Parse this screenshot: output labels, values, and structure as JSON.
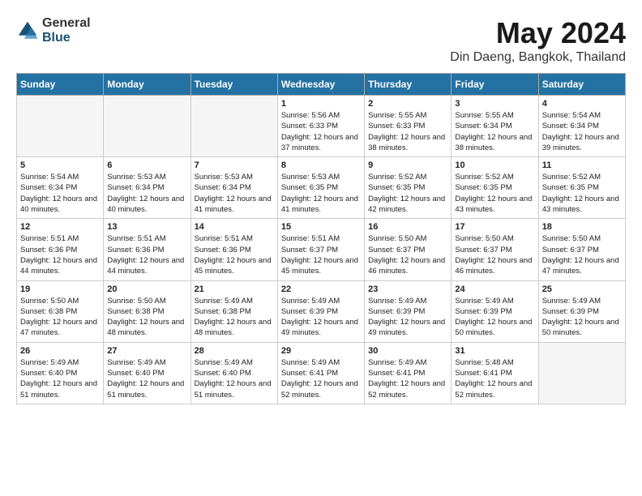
{
  "header": {
    "logo": {
      "general": "General",
      "blue": "Blue"
    },
    "title": "May 2024",
    "subtitle": "Din Daeng, Bangkok, Thailand"
  },
  "weekdays": [
    "Sunday",
    "Monday",
    "Tuesday",
    "Wednesday",
    "Thursday",
    "Friday",
    "Saturday"
  ],
  "weeks": [
    [
      {
        "day": "",
        "empty": true
      },
      {
        "day": "",
        "empty": true
      },
      {
        "day": "",
        "empty": true
      },
      {
        "day": "1",
        "sunrise": "5:56 AM",
        "sunset": "6:33 PM",
        "daylight": "12 hours and 37 minutes."
      },
      {
        "day": "2",
        "sunrise": "5:55 AM",
        "sunset": "6:33 PM",
        "daylight": "12 hours and 38 minutes."
      },
      {
        "day": "3",
        "sunrise": "5:55 AM",
        "sunset": "6:34 PM",
        "daylight": "12 hours and 38 minutes."
      },
      {
        "day": "4",
        "sunrise": "5:54 AM",
        "sunset": "6:34 PM",
        "daylight": "12 hours and 39 minutes."
      }
    ],
    [
      {
        "day": "5",
        "sunrise": "5:54 AM",
        "sunset": "6:34 PM",
        "daylight": "12 hours and 40 minutes."
      },
      {
        "day": "6",
        "sunrise": "5:53 AM",
        "sunset": "6:34 PM",
        "daylight": "12 hours and 40 minutes."
      },
      {
        "day": "7",
        "sunrise": "5:53 AM",
        "sunset": "6:34 PM",
        "daylight": "12 hours and 41 minutes."
      },
      {
        "day": "8",
        "sunrise": "5:53 AM",
        "sunset": "6:35 PM",
        "daylight": "12 hours and 41 minutes."
      },
      {
        "day": "9",
        "sunrise": "5:52 AM",
        "sunset": "6:35 PM",
        "daylight": "12 hours and 42 minutes."
      },
      {
        "day": "10",
        "sunrise": "5:52 AM",
        "sunset": "6:35 PM",
        "daylight": "12 hours and 43 minutes."
      },
      {
        "day": "11",
        "sunrise": "5:52 AM",
        "sunset": "6:35 PM",
        "daylight": "12 hours and 43 minutes."
      }
    ],
    [
      {
        "day": "12",
        "sunrise": "5:51 AM",
        "sunset": "6:36 PM",
        "daylight": "12 hours and 44 minutes."
      },
      {
        "day": "13",
        "sunrise": "5:51 AM",
        "sunset": "6:36 PM",
        "daylight": "12 hours and 44 minutes."
      },
      {
        "day": "14",
        "sunrise": "5:51 AM",
        "sunset": "6:36 PM",
        "daylight": "12 hours and 45 minutes."
      },
      {
        "day": "15",
        "sunrise": "5:51 AM",
        "sunset": "6:37 PM",
        "daylight": "12 hours and 45 minutes."
      },
      {
        "day": "16",
        "sunrise": "5:50 AM",
        "sunset": "6:37 PM",
        "daylight": "12 hours and 46 minutes."
      },
      {
        "day": "17",
        "sunrise": "5:50 AM",
        "sunset": "6:37 PM",
        "daylight": "12 hours and 46 minutes."
      },
      {
        "day": "18",
        "sunrise": "5:50 AM",
        "sunset": "6:37 PM",
        "daylight": "12 hours and 47 minutes."
      }
    ],
    [
      {
        "day": "19",
        "sunrise": "5:50 AM",
        "sunset": "6:38 PM",
        "daylight": "12 hours and 47 minutes."
      },
      {
        "day": "20",
        "sunrise": "5:50 AM",
        "sunset": "6:38 PM",
        "daylight": "12 hours and 48 minutes."
      },
      {
        "day": "21",
        "sunrise": "5:49 AM",
        "sunset": "6:38 PM",
        "daylight": "12 hours and 48 minutes."
      },
      {
        "day": "22",
        "sunrise": "5:49 AM",
        "sunset": "6:39 PM",
        "daylight": "12 hours and 49 minutes."
      },
      {
        "day": "23",
        "sunrise": "5:49 AM",
        "sunset": "6:39 PM",
        "daylight": "12 hours and 49 minutes."
      },
      {
        "day": "24",
        "sunrise": "5:49 AM",
        "sunset": "6:39 PM",
        "daylight": "12 hours and 50 minutes."
      },
      {
        "day": "25",
        "sunrise": "5:49 AM",
        "sunset": "6:39 PM",
        "daylight": "12 hours and 50 minutes."
      }
    ],
    [
      {
        "day": "26",
        "sunrise": "5:49 AM",
        "sunset": "6:40 PM",
        "daylight": "12 hours and 51 minutes."
      },
      {
        "day": "27",
        "sunrise": "5:49 AM",
        "sunset": "6:40 PM",
        "daylight": "12 hours and 51 minutes."
      },
      {
        "day": "28",
        "sunrise": "5:49 AM",
        "sunset": "6:40 PM",
        "daylight": "12 hours and 51 minutes."
      },
      {
        "day": "29",
        "sunrise": "5:49 AM",
        "sunset": "6:41 PM",
        "daylight": "12 hours and 52 minutes."
      },
      {
        "day": "30",
        "sunrise": "5:49 AM",
        "sunset": "6:41 PM",
        "daylight": "12 hours and 52 minutes."
      },
      {
        "day": "31",
        "sunrise": "5:48 AM",
        "sunset": "6:41 PM",
        "daylight": "12 hours and 52 minutes."
      },
      {
        "day": "",
        "empty": true
      }
    ]
  ]
}
